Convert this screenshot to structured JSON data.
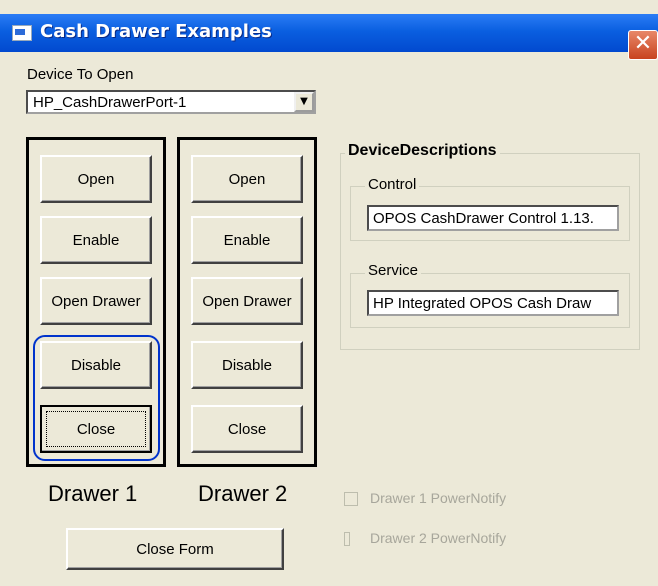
{
  "window": {
    "title": "Cash Drawer Examples",
    "close_glyph": "✕"
  },
  "device": {
    "label": "Device To Open",
    "selected": "HP_CashDrawerPort-1",
    "dropdown_glyph": "▼"
  },
  "drawer1": {
    "caption": "Drawer 1",
    "buttons": {
      "open": "Open",
      "enable": "Enable",
      "open_drawer": "Open Drawer",
      "disable": "Disable",
      "close": "Close"
    }
  },
  "drawer2": {
    "caption": "Drawer 2",
    "buttons": {
      "open": "Open",
      "enable": "Enable",
      "open_drawer": "Open Drawer",
      "disable": "Disable",
      "close": "Close"
    }
  },
  "descriptions": {
    "title": "DeviceDescriptions",
    "control": {
      "label": "Control",
      "value": "OPOS CashDrawer Control 1.13."
    },
    "service": {
      "label": "Service",
      "value": "HP Integrated OPOS Cash Draw"
    }
  },
  "checkboxes": {
    "drawer1_power": {
      "label": "Drawer 1 PowerNotify",
      "checked": false,
      "enabled": false
    },
    "drawer2_power": {
      "label": "Drawer 2 PowerNotify",
      "checked": false,
      "enabled": false
    }
  },
  "close_form": "Close Form",
  "colors": {
    "titlebar": "#0a5fe0",
    "face": "#ece9d8",
    "highlight_group": "#0033cc"
  }
}
